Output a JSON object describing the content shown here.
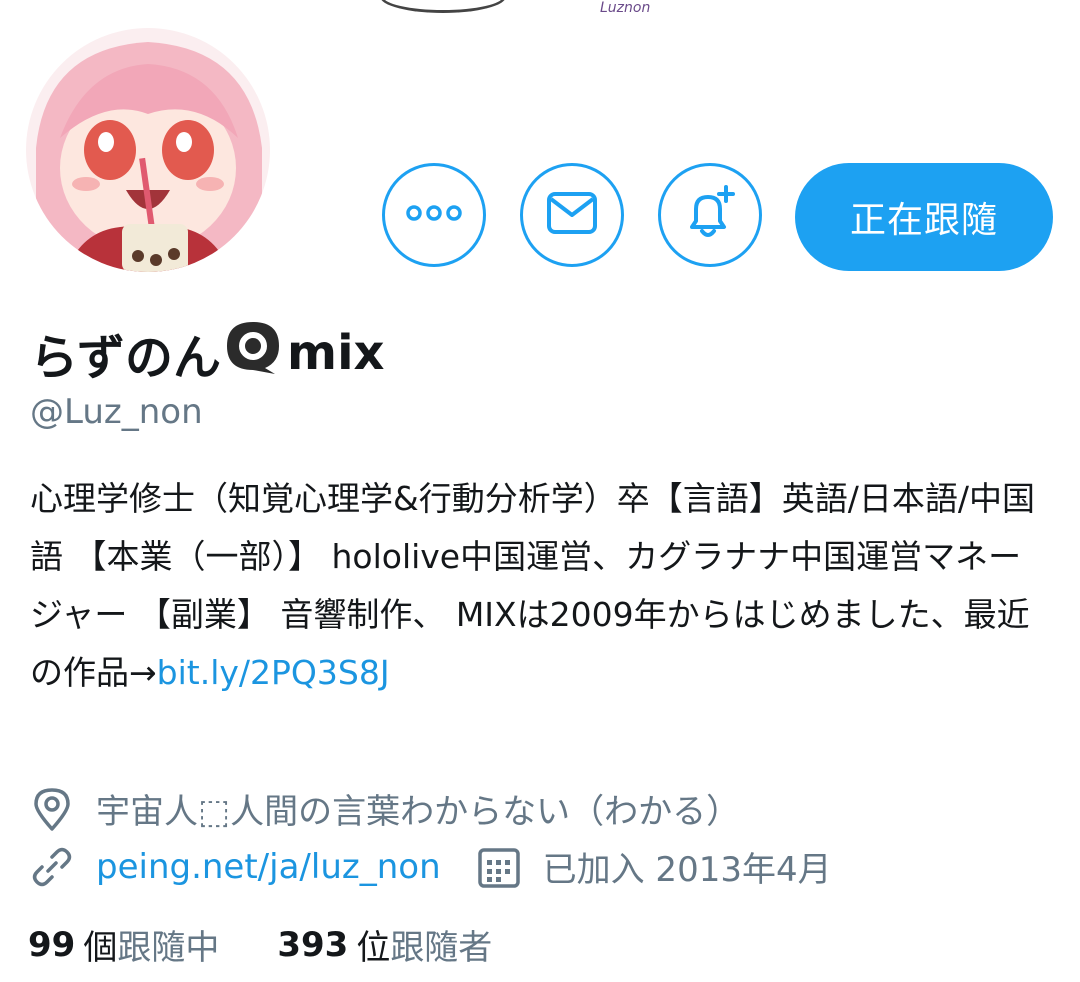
{
  "banner": {
    "signature": "Luznon"
  },
  "profile": {
    "display_name_prefix": "らずのん",
    "display_name_suffix": "mix",
    "handle": "@Luz_non",
    "bio_text": "心理学修士（知覚心理学&行動分析学）卒【言語】英語/日本語/中国語 【本業（一部）】 hololive中国運営、カグラナナ中国運営マネージャー 【副業】 音響制作、 MIXは2009年からはじめました、最近の作品→",
    "bio_link": "bit.ly/2PQ3S8J",
    "location": "宇宙人⬚人間の言葉わからない（わかる）",
    "website": "peing.net/ja/luz_non",
    "joined": "已加入 2013年4月"
  },
  "actions": {
    "more_icon": "more-dots-icon",
    "message_icon": "envelope-icon",
    "notify_icon": "bell-plus-icon",
    "follow_label": "正在跟隨"
  },
  "stats": {
    "following_count": "99",
    "following_unit": "個",
    "following_label": "跟隨中",
    "followers_count": "393",
    "followers_unit": "位",
    "followers_label": "跟隨者"
  },
  "colors": {
    "accent": "#1da1f2",
    "secondary_text": "#657786",
    "link": "#1b95e0"
  }
}
